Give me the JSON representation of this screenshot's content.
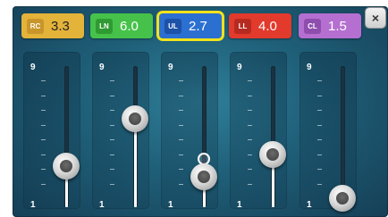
{
  "controls": [
    {
      "code": "RC",
      "value": "3.3",
      "badge_bg": "#e3b33a",
      "text_color": "#222222",
      "code_bg": "#c8962a",
      "level": 0.29,
      "selected": false
    },
    {
      "code": "LN",
      "value": "6.0",
      "badge_bg": "#46c24a",
      "text_color": "#ffffff",
      "code_bg": "#2f9a32",
      "level": 0.625,
      "selected": false
    },
    {
      "code": "UL",
      "value": "2.7",
      "badge_bg": "#2b6fd1",
      "text_color": "#ffffff",
      "code_bg": "#1c52a8",
      "level": 0.215,
      "selected": true,
      "marker_level": 0.34
    },
    {
      "code": "LL",
      "value": "4.0",
      "badge_bg": "#e23a2c",
      "text_color": "#ffffff",
      "code_bg": "#b72a1f",
      "level": 0.375,
      "selected": false
    },
    {
      "code": "CL",
      "value": "1.5",
      "badge_bg": "#b46fd0",
      "text_color": "#ffffff",
      "code_bg": "#8f4eae",
      "level": 0.065,
      "selected": false
    }
  ],
  "scale": {
    "max_label": "9",
    "min_label": "1"
  },
  "close_button": {
    "label": "×"
  }
}
